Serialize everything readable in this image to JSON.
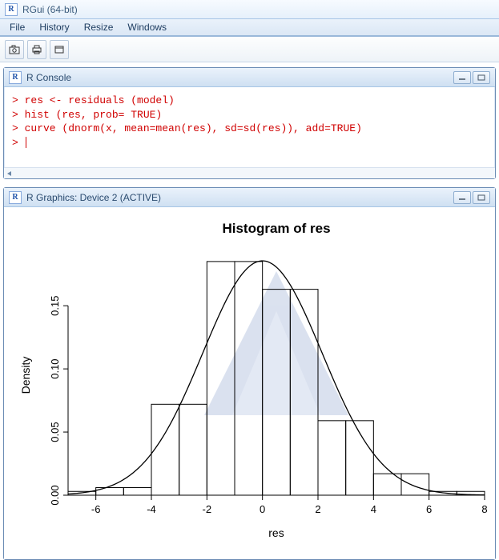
{
  "app": {
    "title": "RGui (64-bit)"
  },
  "menu": {
    "items": [
      "File",
      "History",
      "Resize",
      "Windows"
    ]
  },
  "toolbar": {
    "buttons": [
      "camera-icon",
      "print-icon",
      "window-icon"
    ]
  },
  "console": {
    "title": "R Console",
    "lines": [
      "> res <- residuals (model)",
      "> hist (res, prob= TRUE)",
      "> curve (dnorm(x, mean=mean(res), sd=sd(res)), add=TRUE)",
      "> "
    ]
  },
  "graphics": {
    "title": "R Graphics: Device 2 (ACTIVE)"
  },
  "chart_data": {
    "type": "bar",
    "title": "Histogram of res",
    "xlabel": "res",
    "ylabel": "Density",
    "xlim": [
      -7,
      8
    ],
    "ylim": [
      0,
      0.19
    ],
    "x_ticks": [
      -6,
      -4,
      -2,
      0,
      2,
      4,
      6,
      8
    ],
    "y_ticks": [
      0.0,
      0.05,
      0.1,
      0.15
    ],
    "bins": [
      {
        "from": -7,
        "to": -6,
        "density": 0.003
      },
      {
        "from": -6,
        "to": -5,
        "density": 0.006
      },
      {
        "from": -5,
        "to": -4,
        "density": 0.006
      },
      {
        "from": -4,
        "to": -3,
        "density": 0.072
      },
      {
        "from": -3,
        "to": -2,
        "density": 0.072
      },
      {
        "from": -2,
        "to": -1,
        "density": 0.185
      },
      {
        "from": -1,
        "to": 0,
        "density": 0.185
      },
      {
        "from": 0,
        "to": 1,
        "density": 0.163
      },
      {
        "from": 1,
        "to": 2,
        "density": 0.163
      },
      {
        "from": 2,
        "to": 3,
        "density": 0.059
      },
      {
        "from": 3,
        "to": 4,
        "density": 0.059
      },
      {
        "from": 4,
        "to": 5,
        "density": 0.017
      },
      {
        "from": 5,
        "to": 6,
        "density": 0.017
      },
      {
        "from": 6,
        "to": 7,
        "density": 0.003
      },
      {
        "from": 7,
        "to": 8,
        "density": 0.003
      }
    ],
    "curve": {
      "type": "normal",
      "mean": 0,
      "sd": 2.15
    }
  }
}
